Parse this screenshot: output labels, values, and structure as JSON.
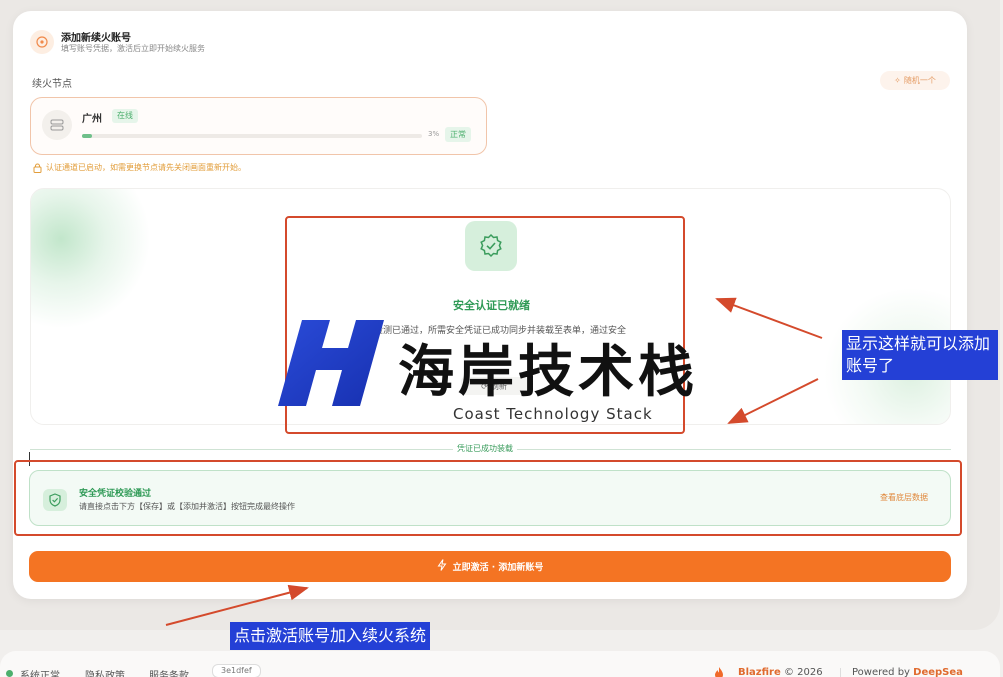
{
  "header": {
    "title": "添加新续火账号",
    "subtitle": "填写账号凭据，激活后立即开始续火服务"
  },
  "node_section": {
    "label": "续火节点",
    "random_label": "随机一个",
    "node": {
      "name": "广州",
      "badge": "在线",
      "progress": 0.03,
      "percent_text": "3%",
      "status": "正常"
    },
    "warning": "认证通道已启动，如需更换节点请先关闭画面重新开始。"
  },
  "auth_panel": {
    "title": "安全认证已就绪",
    "description": "设备检测已通过，所需安全凭证已成功同步并装载至表单，通过安全",
    "refresh_label": "刷新"
  },
  "divider_label": "凭证已成功装载",
  "success_box": {
    "title": "安全凭证校验通过",
    "description": "请直接点击下方【保存】或【添加并激活】按钮完成最终操作",
    "link": "查看底层数据"
  },
  "activate_button": "立即激活 · 添加新账号",
  "annotations": {
    "right_callout": "显示这样就可以添加账号了",
    "bottom_callout": "点击激活账号加入续火系统"
  },
  "watermark": {
    "title": "海岸技术栈",
    "subtitle": "Coast Technology Stack"
  },
  "footer": {
    "status": "系统正常",
    "privacy": "隐私政策",
    "terms": "服务条款",
    "hash": "3e1dfef",
    "brand_name": "Blazfire",
    "brand_copy": "© 2026",
    "powered_prefix": "Powered by",
    "powered_name": "DeepSea"
  },
  "colors": {
    "accent": "#f47423",
    "success": "#2f9a56",
    "annotation_red": "#d44a2c",
    "annotation_blue": "#2440d6"
  }
}
